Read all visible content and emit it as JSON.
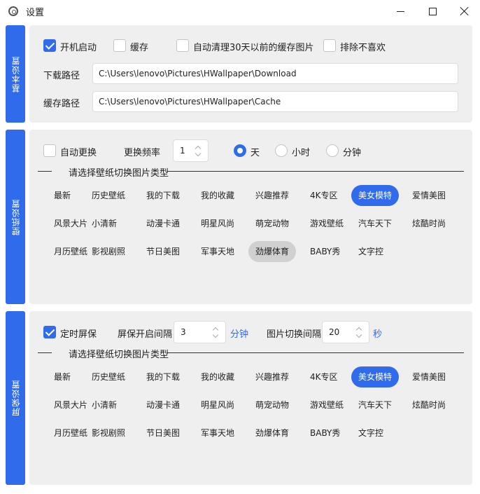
{
  "window": {
    "title": "设置",
    "icon": "app-icon",
    "minimize_icon": "minimize-icon",
    "maximize_icon": "maximize-icon",
    "close_icon": "close-icon"
  },
  "basic": {
    "tab_label": "基本设置",
    "startup_label": "开机启动",
    "startup_checked": true,
    "cache_label": "缓存",
    "cache_checked": false,
    "autoclean_label": "自动清理30天以前的缓存图片",
    "autoclean_checked": false,
    "exclude_label": "排除不喜欢",
    "exclude_checked": false,
    "download_path_label": "下载路径",
    "download_path_value": "C:\\Users\\lenovo\\Pictures\\HWallpaper\\Download",
    "cache_path_label": "缓存路径",
    "cache_path_value": "C:\\Users\\lenovo\\Pictures\\HWallpaper\\Cache"
  },
  "wallpaper": {
    "tab_label": "壁纸设置",
    "auto_change_label": "自动更换",
    "auto_change_checked": false,
    "frequency_label": "更换频率",
    "frequency_value": "1",
    "unit_options": [
      "天",
      "小时",
      "分钟"
    ],
    "unit_selected": "天",
    "category_heading": "请选择壁纸切换图片类型",
    "categories": [
      "最新",
      "历史壁纸",
      "我的下载",
      "我的收藏",
      "兴趣推荐",
      "4K专区",
      "美女模特",
      "爱情美图",
      "风景大片",
      "小清新",
      "动漫卡通",
      "明星风尚",
      "萌宠动物",
      "游戏壁纸",
      "汽车天下",
      "炫酷时尚",
      "月历壁纸",
      "影视剧照",
      "节日美图",
      "军事天地",
      "劲爆体育",
      "BABY秀",
      "文字控"
    ],
    "selected_category": "美女模特",
    "hovered_category": "劲爆体育"
  },
  "screensaver": {
    "tab_label": "屏保设置",
    "timed_label": "定时屏保",
    "timed_checked": true,
    "interval_label": "屏保开启间隔",
    "interval_value": "3",
    "interval_unit": "分钟",
    "switch_label": "图片切换间隔",
    "switch_value": "20",
    "switch_unit": "秒",
    "category_heading": "请选择壁纸切换图片类型",
    "categories": [
      "最新",
      "历史壁纸",
      "我的下载",
      "我的收藏",
      "兴趣推荐",
      "4K专区",
      "美女模特",
      "爱情美图",
      "风景大片",
      "小清新",
      "动漫卡通",
      "明星风尚",
      "萌宠动物",
      "游戏壁纸",
      "汽车天下",
      "炫酷时尚",
      "月历壁纸",
      "影视剧照",
      "节日美图",
      "军事天地",
      "劲爆体育",
      "BABY秀",
      "文字控"
    ],
    "selected_category": "美女模特"
  },
  "colors": {
    "accent": "#2f6bea",
    "panel": "#efefef",
    "hover": "#d0d0d0"
  }
}
